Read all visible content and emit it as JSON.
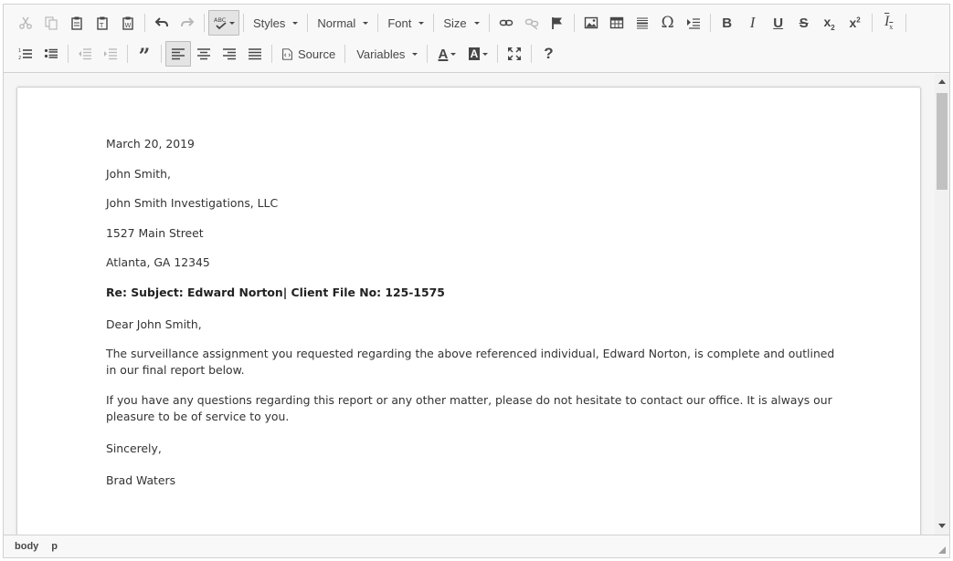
{
  "toolbar": {
    "row1": {
      "styles_label": "Styles",
      "format_label": "Normal",
      "font_label": "Font",
      "size_label": "Size"
    },
    "row2": {
      "source_label": "Source",
      "variables_label": "Variables"
    }
  },
  "document": {
    "date": "March 20, 2019",
    "recipient_name": "John Smith,",
    "recipient_company": "John Smith Investigations, LLC",
    "recipient_street": "1527 Main Street",
    "recipient_city": "Atlanta, GA 12345",
    "subject_line": "Re: Subject: Edward Norton| Client File No: 125-1575",
    "salutation": "Dear John Smith,",
    "paragraph1": "The surveillance assignment you requested regarding the above referenced individual, Edward Norton, is complete and outlined in our final report below.",
    "paragraph2": "If you have any questions regarding this report or any other matter, please do not hesitate to contact our office. It is always our pleasure to be of service to you.",
    "closing": "Sincerely,",
    "signature": "Brad Waters"
  },
  "statusbar": {
    "path": [
      "body",
      "p"
    ]
  },
  "icons": {
    "cut": "cut-icon",
    "copy": "copy-icon",
    "paste": "paste-icon",
    "paste_text": "paste-text-icon",
    "paste_word": "paste-word-icon",
    "undo": "undo-icon",
    "redo": "redo-icon",
    "spellcheck": "spellcheck-icon",
    "link": "link-icon",
    "unlink": "unlink-icon",
    "anchor": "anchor-flag-icon",
    "image": "image-icon",
    "table": "table-icon",
    "hr": "horizontal-line-icon",
    "special_char": "omega-icon",
    "page_break": "page-break-icon",
    "bold": "bold-icon",
    "italic": "italic-icon",
    "underline": "underline-icon",
    "strike": "strikethrough-icon",
    "subscript": "subscript-icon",
    "superscript": "superscript-icon",
    "remove_format": "remove-format-icon",
    "numbered_list": "numbered-list-icon",
    "bulleted_list": "bulleted-list-icon",
    "outdent": "outdent-icon",
    "indent": "indent-icon",
    "blockquote": "blockquote-icon",
    "align_left": "align-left-icon",
    "align_center": "align-center-icon",
    "align_right": "align-right-icon",
    "justify": "justify-icon",
    "source": "source-icon",
    "text_color": "text-color-icon",
    "bg_color": "background-color-icon",
    "maximize": "maximize-icon",
    "help": "help-icon"
  },
  "colors": {
    "toolbar_bg": "#f8f8f8",
    "border": "#d1d1d1",
    "icon": "#474747",
    "icon_disabled": "#b8b8b8",
    "text": "#333333"
  }
}
